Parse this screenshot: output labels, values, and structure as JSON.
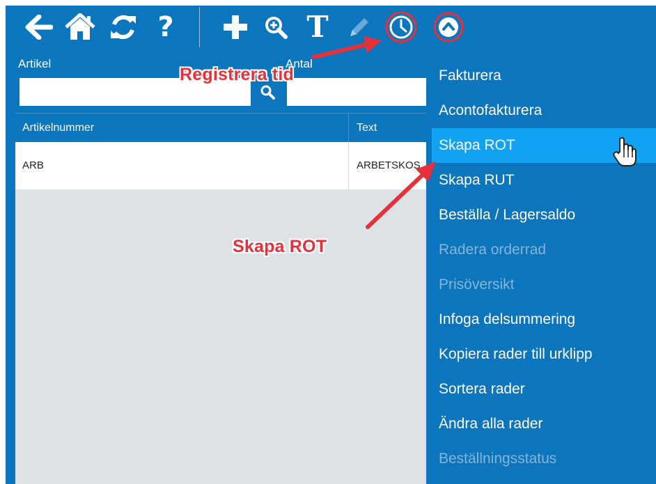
{
  "toolbar": {
    "icons": [
      "arrow-left-icon",
      "home-icon",
      "refresh-icon",
      "help-icon",
      "plus-icon",
      "zoom-icon",
      "text-icon",
      "pencil-icon",
      "clock-icon",
      "chevron-up-icon"
    ],
    "help_glyph": "?",
    "text_glyph": "T"
  },
  "search": {
    "artikel_label": "Artikel",
    "artikel_value": "",
    "antal_label": "Antal",
    "antal_value": ""
  },
  "grid": {
    "columns": [
      "Artikelnummer",
      "Text"
    ],
    "rows": [
      {
        "artikelnummer": "ARB",
        "text": "ARBETSKOS"
      }
    ]
  },
  "menu": {
    "items": [
      {
        "label": "Fakturera",
        "state": "enabled"
      },
      {
        "label": "Acontofakturera",
        "state": "enabled"
      },
      {
        "label": "Skapa ROT",
        "state": "hover"
      },
      {
        "label": "Skapa RUT",
        "state": "enabled"
      },
      {
        "label": "Beställa / Lagersaldo",
        "state": "enabled"
      },
      {
        "label": "Radera orderrad",
        "state": "disabled"
      },
      {
        "label": "Prisöversikt",
        "state": "disabled"
      },
      {
        "label": "Infoga delsummering",
        "state": "enabled"
      },
      {
        "label": "Kopiera rader till urklipp",
        "state": "enabled"
      },
      {
        "label": "Sortera rader",
        "state": "enabled"
      },
      {
        "label": "Ändra alla rader",
        "state": "enabled"
      },
      {
        "label": "Beställningsstatus",
        "state": "disabled"
      }
    ]
  },
  "annotations": {
    "registrera_tid": "Registrera tid",
    "skapa_rot": "Skapa ROT"
  },
  "colors": {
    "brand_blue": "#0b75bd",
    "hover_blue": "#12a2f4",
    "annotation_red": "#e8303a",
    "grid_empty": "#dde2e7"
  }
}
